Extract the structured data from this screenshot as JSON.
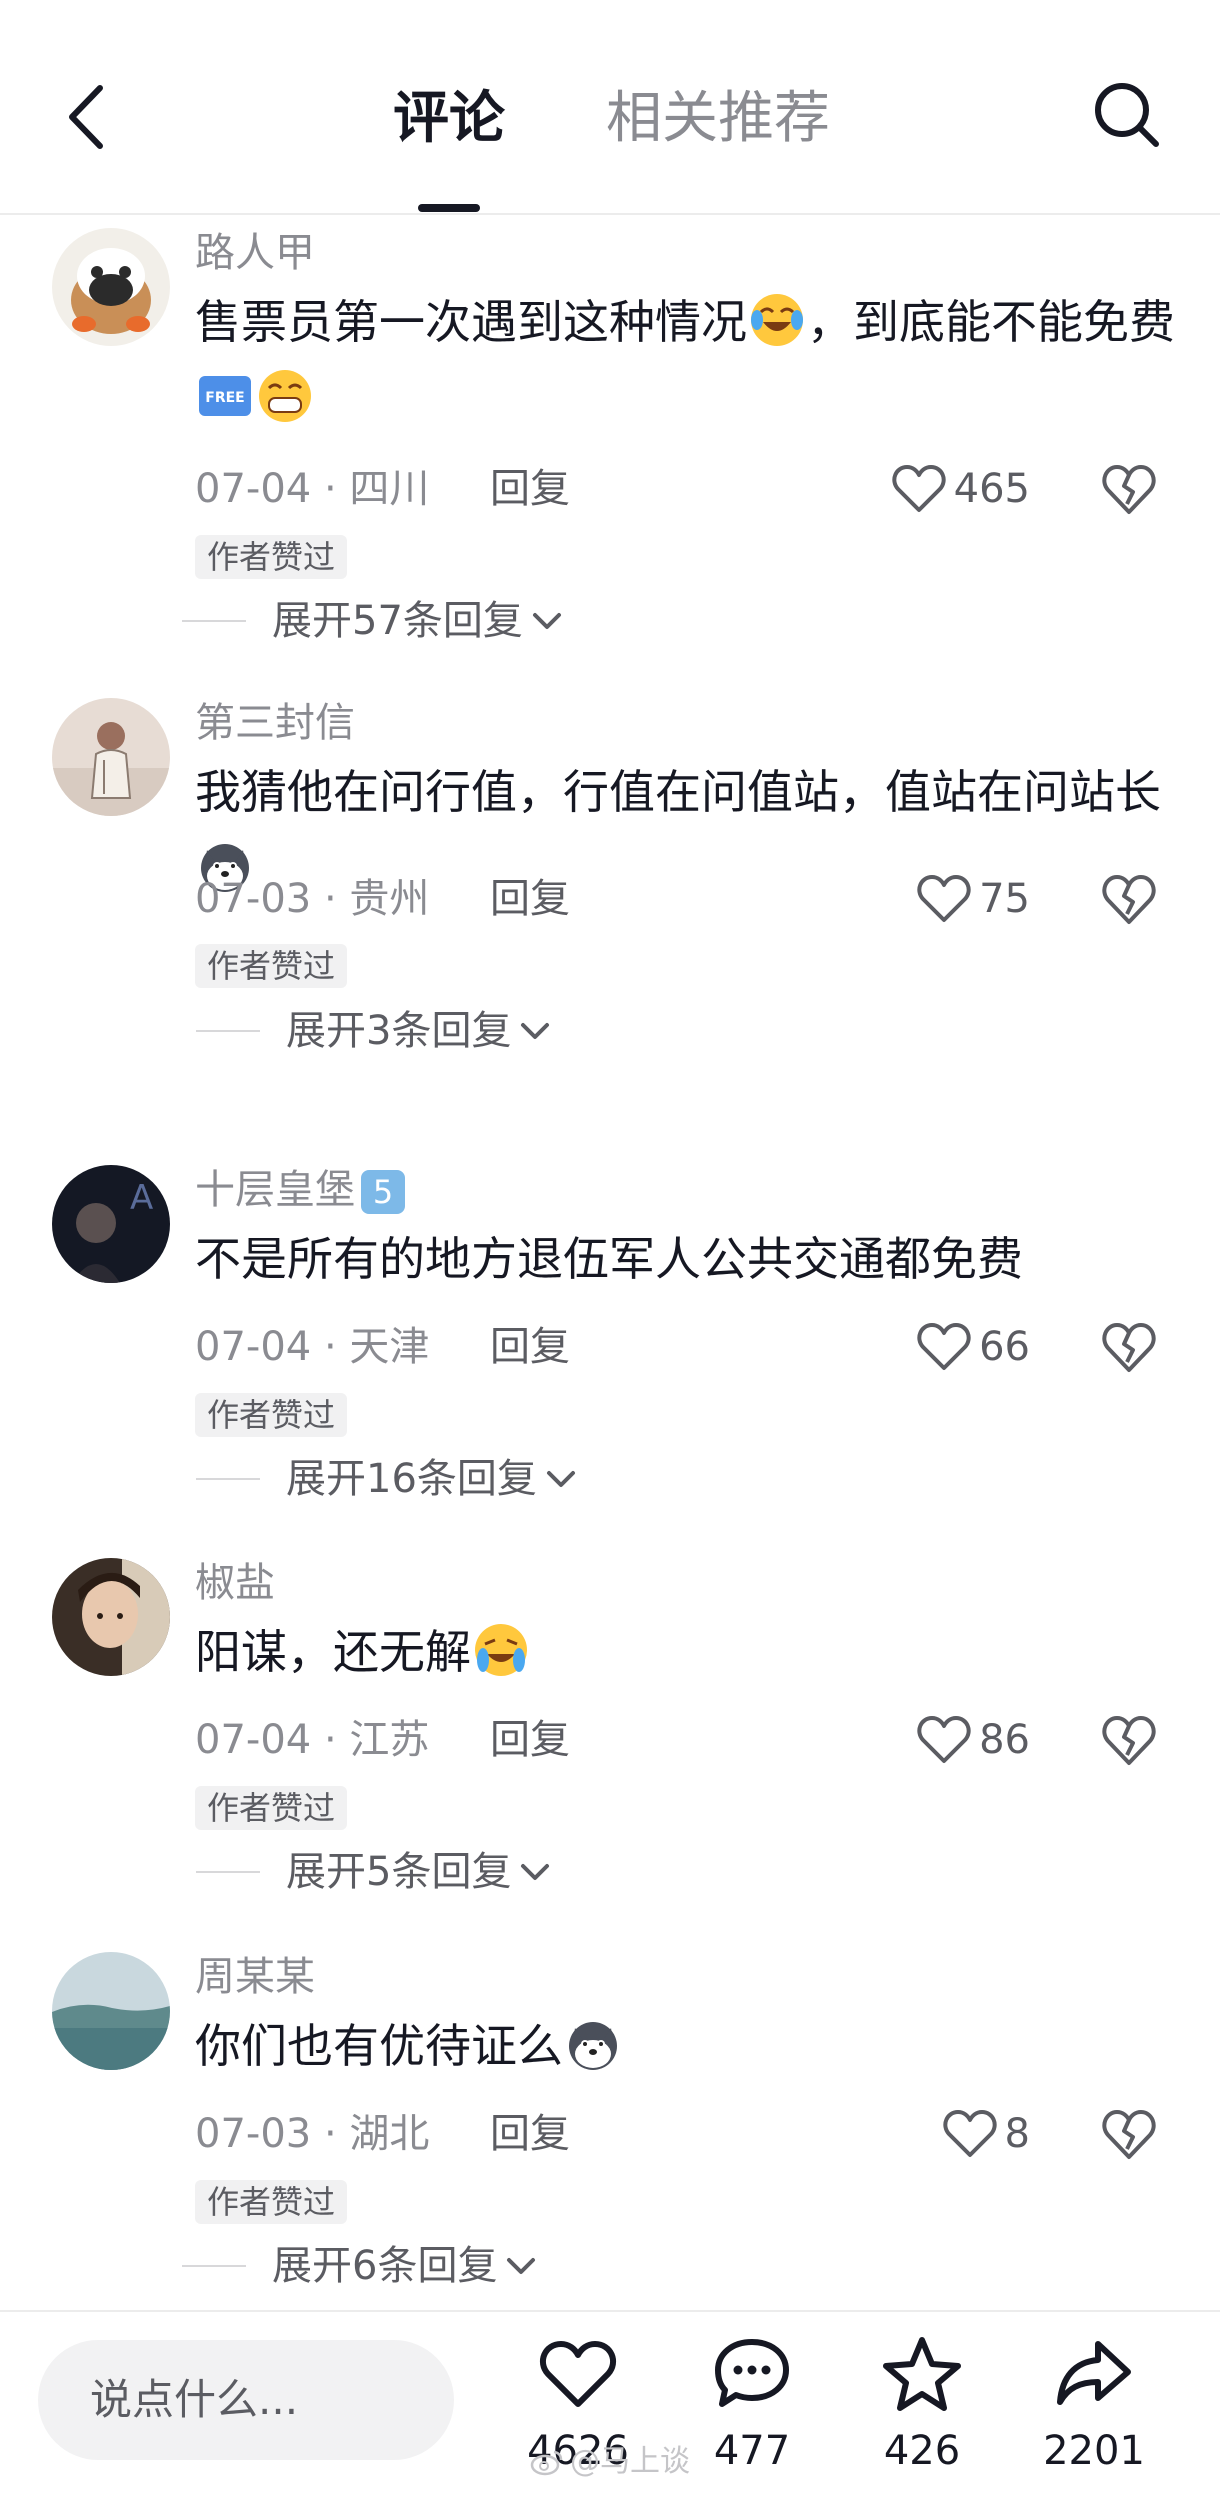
{
  "header": {
    "tab_comments": "评论",
    "tab_related": "相关推荐",
    "back_icon": "chevron-left-icon",
    "search_icon": "search-icon"
  },
  "comments": [
    {
      "username": "路人甲",
      "text_part1": "售票员第一次遇到这种情况",
      "text_part2": "，到底能不能免费",
      "date": "07-04 · 四川",
      "reply": "回复",
      "likes": "465",
      "author_liked": "作者赞过",
      "expand": "展开57条回复"
    },
    {
      "username": "第三封信",
      "text_part1": "我猜他在问行值，行值在问值站，值站在问站长",
      "date": "07-03 · 贵州",
      "reply": "回复",
      "likes": "75",
      "author_liked": "作者赞过",
      "expand": "展开3条回复"
    },
    {
      "username": "十层皇堡",
      "level": "5",
      "text_part1": "不是所有的地方退伍军人公共交通都免费",
      "date": "07-04 · 天津",
      "reply": "回复",
      "likes": "66",
      "author_liked": "作者赞过",
      "expand": "展开16条回复"
    },
    {
      "username": "椒盐",
      "text_part1": "阳谋，还无解",
      "date": "07-04 · 江苏",
      "reply": "回复",
      "likes": "86",
      "author_liked": "作者赞过",
      "expand": "展开5条回复"
    },
    {
      "username": "周某某",
      "text_part1": "你们也有优待证么",
      "date": "07-03 · 湖北",
      "reply": "回复",
      "likes": "8",
      "author_liked": "作者赞过",
      "expand": "展开6条回复"
    }
  ],
  "bottom_bar": {
    "input_placeholder": "说点什么...",
    "like_count": "4626",
    "comment_count": "477",
    "favorite_count": "426",
    "share_count": "2201"
  },
  "watermark": "@马上谈",
  "colors": {
    "primary_text": "#161823",
    "secondary_text": "#8a8b91",
    "divider": "#ececec"
  }
}
